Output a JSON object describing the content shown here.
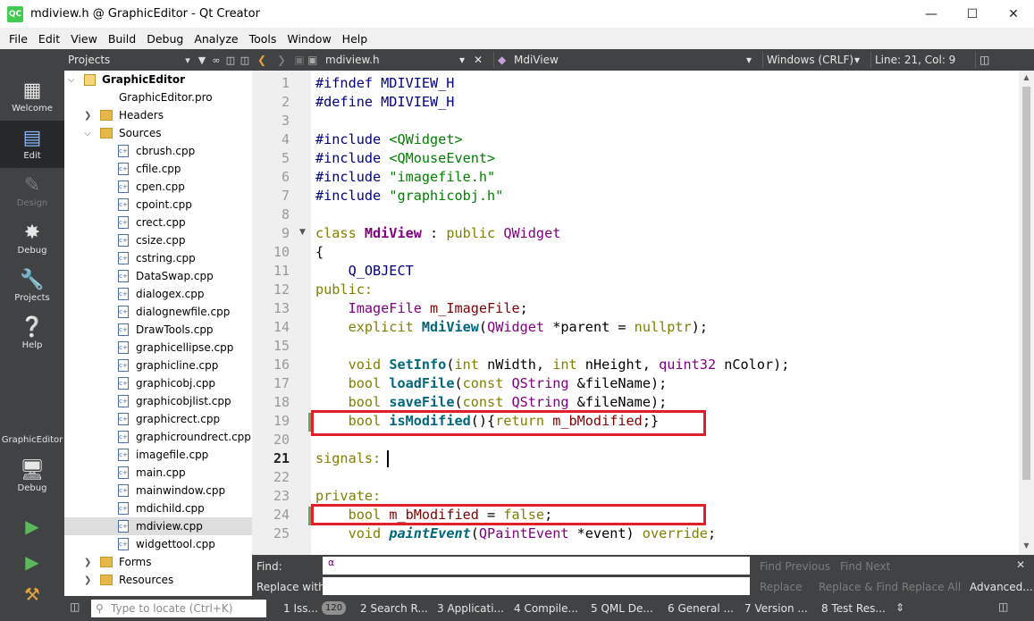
{
  "window": {
    "title": "mdiview.h @ GraphicEditor - Qt Creator",
    "app_icon_text": "QC"
  },
  "menu": [
    "File",
    "Edit",
    "View",
    "Build",
    "Debug",
    "Analyze",
    "Tools",
    "Window",
    "Help"
  ],
  "modes": [
    {
      "label": "Welcome",
      "icon": "grid-icon",
      "state": "normal"
    },
    {
      "label": "Edit",
      "icon": "document-icon",
      "state": "active"
    },
    {
      "label": "Design",
      "icon": "pencil-icon",
      "state": "disabled"
    },
    {
      "label": "Debug",
      "icon": "bug-icon",
      "state": "normal"
    },
    {
      "label": "Projects",
      "icon": "wrench-icon",
      "state": "normal"
    },
    {
      "label": "Help",
      "icon": "question-icon",
      "state": "normal"
    }
  ],
  "kit_selector": {
    "project": "GraphicEditor",
    "build": "Debug"
  },
  "project_pane": {
    "title": "Projects"
  },
  "tree": {
    "root": "GraphicEditor",
    "pro_file": "GraphicEditor.pro",
    "headers": "Headers",
    "sources": "Sources",
    "files": [
      "cbrush.cpp",
      "cfile.cpp",
      "cpen.cpp",
      "cpoint.cpp",
      "crect.cpp",
      "csize.cpp",
      "cstring.cpp",
      "DataSwap.cpp",
      "dialogex.cpp",
      "dialognewfile.cpp",
      "DrawTools.cpp",
      "graphicellipse.cpp",
      "graphicline.cpp",
      "graphicobj.cpp",
      "graphicobjlist.cpp",
      "graphicrect.cpp",
      "graphicroundrect.cpp",
      "imagefile.cpp",
      "main.cpp",
      "mainwindow.cpp",
      "mdichild.cpp",
      "mdiview.cpp",
      "widgettool.cpp"
    ],
    "selected": "mdiview.cpp",
    "forms": "Forms",
    "resources": "Resources"
  },
  "editor": {
    "file": "mdiview.h",
    "symbol": "MdiView",
    "line_ending": "Windows (CRLF)",
    "position": "Line: 21, Col: 9",
    "current_line": 21
  },
  "code_lines": [
    {
      "n": "1"
    },
    {
      "n": "2"
    },
    {
      "n": "3"
    },
    {
      "n": "4"
    },
    {
      "n": "5"
    },
    {
      "n": "6"
    },
    {
      "n": "7"
    },
    {
      "n": "8"
    },
    {
      "n": "9"
    },
    {
      "n": "10"
    },
    {
      "n": "11"
    },
    {
      "n": "12"
    },
    {
      "n": "13"
    },
    {
      "n": "14"
    },
    {
      "n": "15"
    },
    {
      "n": "16"
    },
    {
      "n": "17"
    },
    {
      "n": "18"
    },
    {
      "n": "19"
    },
    {
      "n": "20"
    },
    {
      "n": "21"
    },
    {
      "n": "22"
    },
    {
      "n": "23"
    },
    {
      "n": "24"
    },
    {
      "n": "25"
    }
  ],
  "code": {
    "l1a": "#ifndef",
    "l1b": " MDIVIEW_H",
    "l2a": "#define",
    "l2b": " MDIVIEW_H",
    "l4a": "#include",
    "l4b": "<QWidget>",
    "l5a": "#include",
    "l5b": "<QMouseEvent>",
    "l6a": "#include",
    "l6b": "\"imagefile.h\"",
    "l7a": "#include",
    "l7b": "\"graphicobj.h\"",
    "l9a": "class",
    "l9b": "MdiView",
    "l9c": " : ",
    "l9d": "public",
    "l9e": "QWidget",
    "l10": "{",
    "l11": "Q_OBJECT",
    "l12": "public:",
    "l13a": "ImageFile",
    "l13b": "m_ImageFile",
    "l14a": "explicit",
    "l14b": "MdiView",
    "l14c": "QWidget",
    "l14d": "*parent = ",
    "l14e": "nullptr",
    "l16a": "void",
    "l16b": "SetInfo",
    "l16c": "int",
    "l16d": " nWidth, ",
    "l16e": "int",
    "l16f": " nHeight, ",
    "l16g": "quint32",
    "l16h": " nColor);",
    "l17a": "bool",
    "l17b": "loadFile",
    "l17c": "const",
    "l17d": "QString",
    "l17e": "&fileName",
    "l18a": "bool",
    "l18b": "saveFile",
    "l18c": "const",
    "l18d": "QString",
    "l18e": "&fileName",
    "l19a": "bool",
    "l19b": "isModified",
    "l19c": "(){",
    "l19d": "return",
    "l19e": "m_bModified",
    "l21": "signals:",
    "l23": "private:",
    "l24a": "bool",
    "l24b": "m_bModified",
    "l24c": "false",
    "l25a": "void",
    "l25b": "paintEvent",
    "l25c": "QPaintEvent",
    "l25d": " *event) ",
    "l25e": "override"
  },
  "find": {
    "find_label": "Find:",
    "replace_label": "Replace with:",
    "find_prev": "Find Previous",
    "find_next": "Find Next",
    "replace": "Replace",
    "replace_find": "Replace & Find",
    "replace_all": "Replace All",
    "advanced": "Advanced..."
  },
  "status": {
    "locator_placeholder": "Type to locate (Ctrl+K)",
    "tabs": [
      "1  Iss...",
      "2  Search R...",
      "3  Applicati...",
      "4  Compile...",
      "5  QML De...",
      "6  General ...",
      "7  Version ...",
      "8  Test Res..."
    ],
    "issues_count": "120"
  }
}
